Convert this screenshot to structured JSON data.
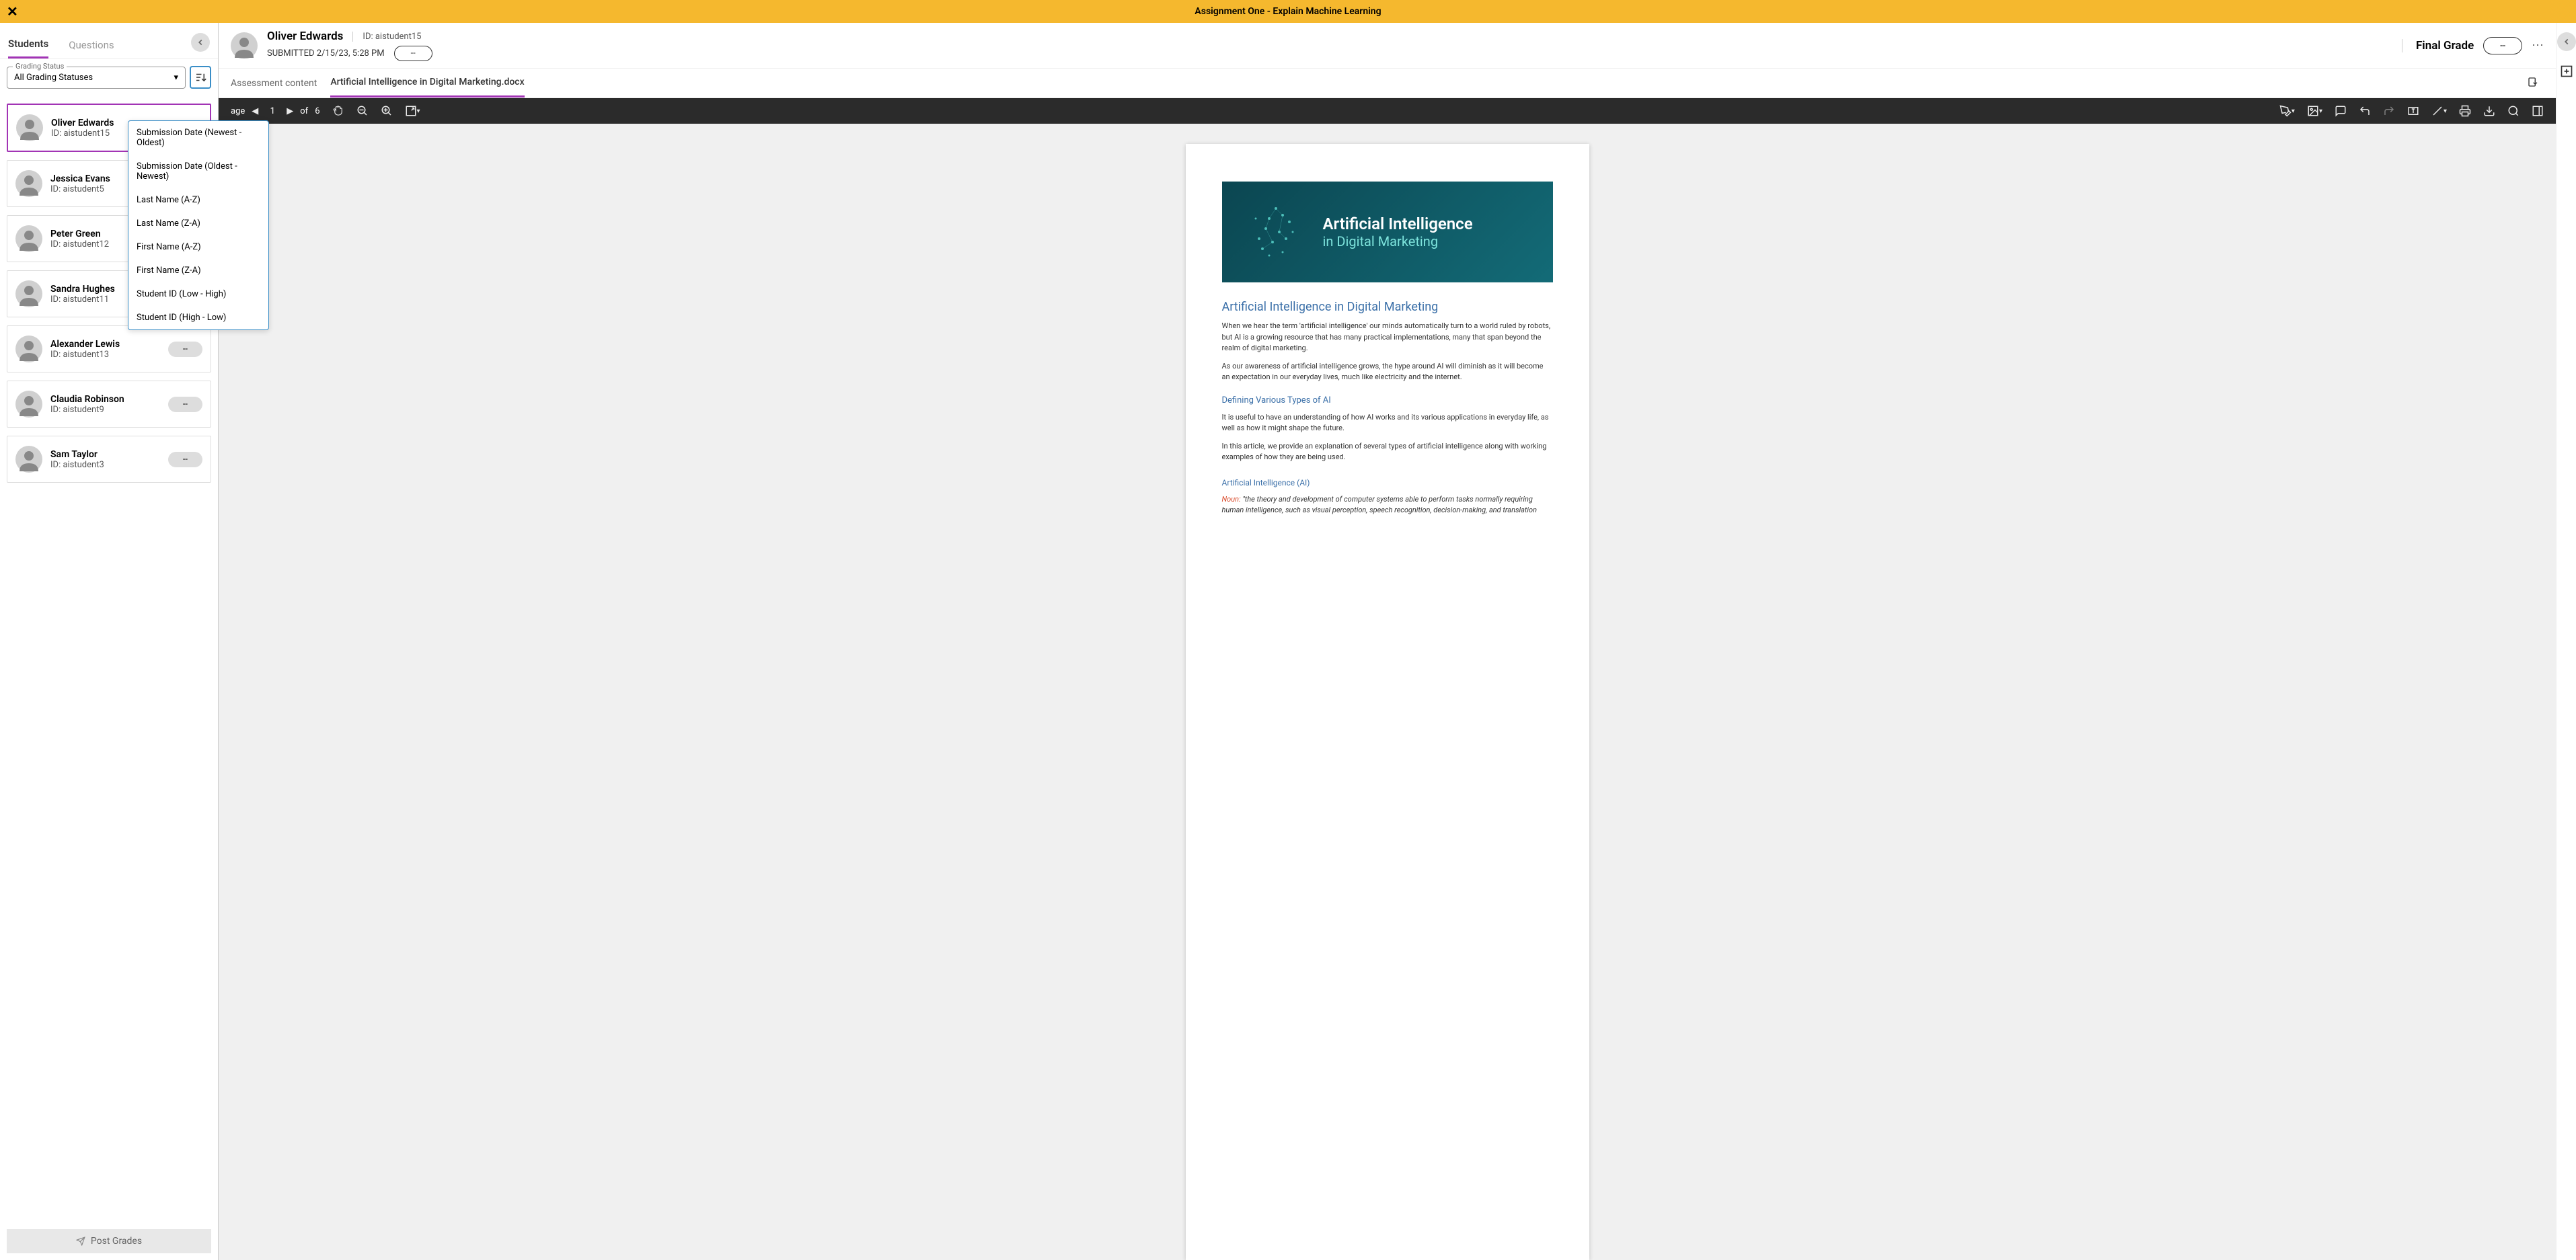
{
  "header": {
    "title": "Assignment One - Explain Machine Learning"
  },
  "sidebar": {
    "tabs": {
      "students": "Students",
      "questions": "Questions"
    },
    "filter": {
      "label": "Grading Status",
      "value": "All Grading Statuses"
    },
    "sortOptions": [
      "Submission Date (Newest - Oldest)",
      "Submission Date (Oldest - Newest)",
      "Last Name (A-Z)",
      "Last Name (Z-A)",
      "First Name (A-Z)",
      "First Name (Z-A)",
      "Student ID (Low - High)",
      "Student ID (High - Low)"
    ],
    "students": [
      {
        "name": "Oliver Edwards",
        "id": "ID: aistudent15",
        "grade": null
      },
      {
        "name": "Jessica Evans",
        "id": "ID: aistudent5",
        "grade": null
      },
      {
        "name": "Peter Green",
        "id": "ID: aistudent12",
        "grade": null
      },
      {
        "name": "Sandra Hughes",
        "id": "ID: aistudent11",
        "grade": "--"
      },
      {
        "name": "Alexander Lewis",
        "id": "ID: aistudent13",
        "grade": "--"
      },
      {
        "name": "Claudia Robinson",
        "id": "ID: aistudent9",
        "grade": "--"
      },
      {
        "name": "Sam Taylor",
        "id": "ID: aistudent3",
        "grade": "--"
      }
    ],
    "postGrades": "Post Grades"
  },
  "submission": {
    "name": "Oliver Edwards",
    "idLabel": "ID: aistudent15",
    "submittedLabel": "SUBMITTED 2/15/23, 5:28 PM",
    "attemptGrade": "--",
    "finalGradeLabel": "Final Grade",
    "finalGrade": "--"
  },
  "subtabs": {
    "assessment": "Assessment content",
    "file": "Artificial Intelligence in Digital Marketing.docx"
  },
  "viewer": {
    "pageLabel": "age",
    "currentPage": "1",
    "ofLabel": "of",
    "totalPages": "6"
  },
  "doc": {
    "heroLine1": "Artificial Intelligence",
    "heroLine2": "in Digital Marketing",
    "h1": "Artificial Intelligence in Digital Marketing",
    "p1": "When we hear the term 'artificial intelligence' our minds automatically turn to a world ruled by robots, but AI is a growing resource that has many practical implementations, many that span beyond the realm of digital marketing.",
    "p2": "As our awareness of artificial intelligence grows, the hype around AI will diminish as it will become an expectation in our everyday lives, much like electricity and the internet.",
    "h2": "Defining Various Types of AI",
    "p3": "It is useful to have an understanding of how AI works and its various applications in everyday life, as well as how it might shape the future.",
    "p4": "In this article, we provide an explanation of several types of artificial intelligence along with working examples of how they are being used.",
    "h3": "Artificial Intelligence (AI)",
    "noun": "Noun:",
    "def": "\"the theory and development of computer systems able to perform tasks normally requiring human intelligence, such as visual perception, speech recognition, decision-making, and translation"
  }
}
